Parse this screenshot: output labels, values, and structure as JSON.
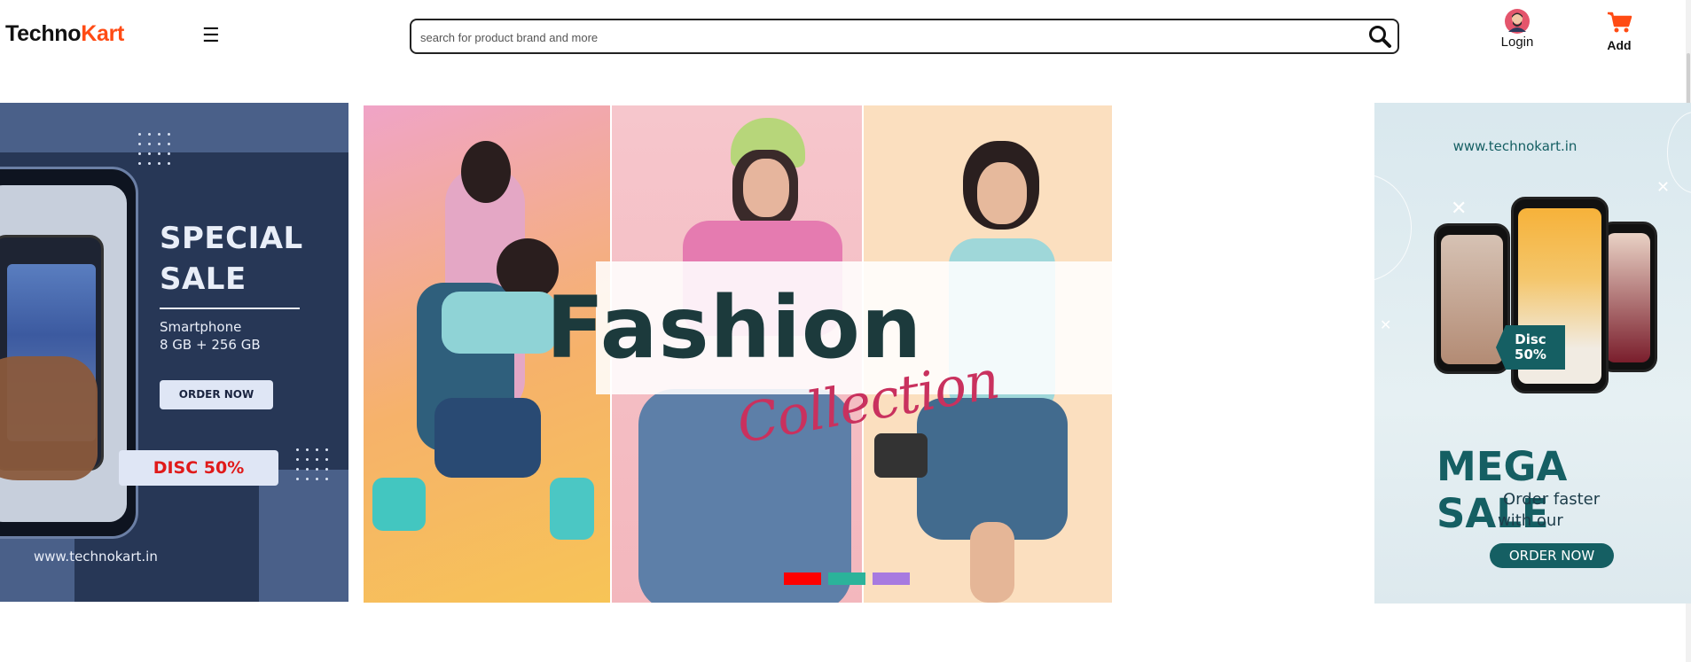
{
  "header": {
    "logo_part1": "Techno",
    "logo_part2": "Kart",
    "menu_icon": "☰",
    "search_placeholder": "search for product brand and more",
    "login_label": "Login",
    "cart_label": "Add"
  },
  "left_banner": {
    "headline_line1": "SPECIAL",
    "headline_line2": "SALE",
    "product": "Smartphone",
    "specs": "8 GB + 256 GB",
    "order_button": "ORDER NOW",
    "discount": "DISC 50%",
    "url": "www.technokart.in"
  },
  "center_banner": {
    "title": "Fashion",
    "subtitle": "Collection",
    "indicators": [
      "#ff0000",
      "#2bb39a",
      "#a77ae0"
    ]
  },
  "right_banner": {
    "url": "www.technokart.in",
    "badge_line1": "Disc",
    "badge_line2": "50%",
    "headline": "MEGA SALE",
    "tagline_line1": "Order faster",
    "tagline_line2": "with our",
    "order_button": "ORDER NOW"
  },
  "colors": {
    "brand_accent": "#ff4b14",
    "left_banner_bg": "#273756",
    "right_banner_accent": "#155f63",
    "fashion_title": "#1c3a3c",
    "collection_script": "#c9315e"
  }
}
